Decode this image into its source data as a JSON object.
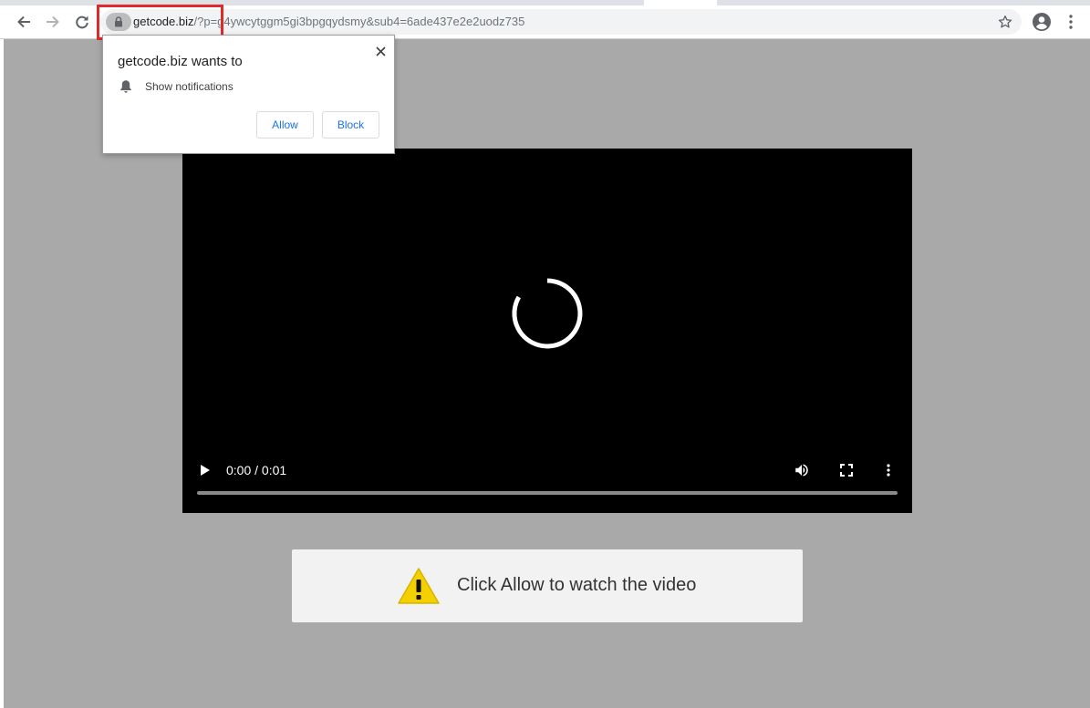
{
  "browser": {
    "url_host": "getcode.biz",
    "url_path": "/?p=g4ywcytggm5gi3bpgqydsmy&sub4=6ade437e2e2uodz735",
    "icons": {
      "back": "back-arrow-icon",
      "forward": "forward-arrow-icon",
      "reload": "reload-icon",
      "lock": "lock-icon",
      "bookmark": "star-icon",
      "profile": "account-circle-icon",
      "menu": "vertical-dots-icon"
    },
    "highlight_color": "#e02a2a"
  },
  "notification_prompt": {
    "title": "getcode.biz wants to",
    "permission": "Show notifications",
    "allow_label": "Allow",
    "block_label": "Block",
    "icons": {
      "close": "close-icon",
      "permission": "bell-icon"
    },
    "button_text_color": "#1a73e8"
  },
  "video_player": {
    "time": "0:00 / 0:01",
    "progress_fraction": 0,
    "state": "loading",
    "icons": {
      "play": "play-icon",
      "volume": "volume-icon",
      "fullscreen": "fullscreen-icon",
      "more": "vertical-dots-icon",
      "loading": "spinner-icon"
    }
  },
  "banner": {
    "message": "Click Allow to watch the video",
    "icon": "warning-icon",
    "icon_color": "#f5d000"
  },
  "colors": {
    "page_background": "#a9a9a9",
    "video_background": "#000000"
  }
}
